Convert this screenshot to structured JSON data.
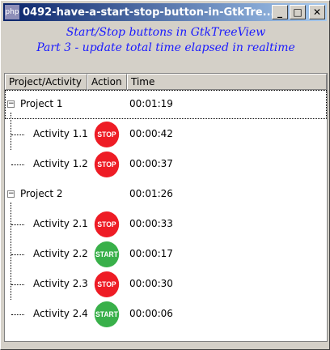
{
  "window": {
    "app_icon": "php",
    "title": "0492-have-a-start-stop-button-in-GtkTre...",
    "minimize": "_",
    "maximize": "□",
    "close": "✕"
  },
  "subtitle": {
    "line1": "Start/Stop buttons in GtkTreeView",
    "line2": "Part 3 - update total time elapsed in realtime"
  },
  "columns": [
    "Project/Activity",
    "Action",
    "Time"
  ],
  "colors": {
    "stop": "#ee1c25",
    "start": "#39b04a"
  },
  "projects": [
    {
      "name": "Project 1",
      "time": "00:01:19",
      "activities": [
        {
          "name": "Activity 1.1",
          "action": "STOP",
          "time": "00:00:42"
        },
        {
          "name": "Activity 1.2",
          "action": "STOP",
          "time": "00:00:37"
        }
      ]
    },
    {
      "name": "Project 2",
      "time": "00:01:26",
      "activities": [
        {
          "name": "Activity 2.1",
          "action": "STOP",
          "time": "00:00:33"
        },
        {
          "name": "Activity 2.2",
          "action": "START",
          "time": "00:00:17"
        },
        {
          "name": "Activity 2.3",
          "action": "STOP",
          "time": "00:00:30"
        },
        {
          "name": "Activity 2.4",
          "action": "START",
          "time": "00:00:06"
        }
      ]
    }
  ]
}
